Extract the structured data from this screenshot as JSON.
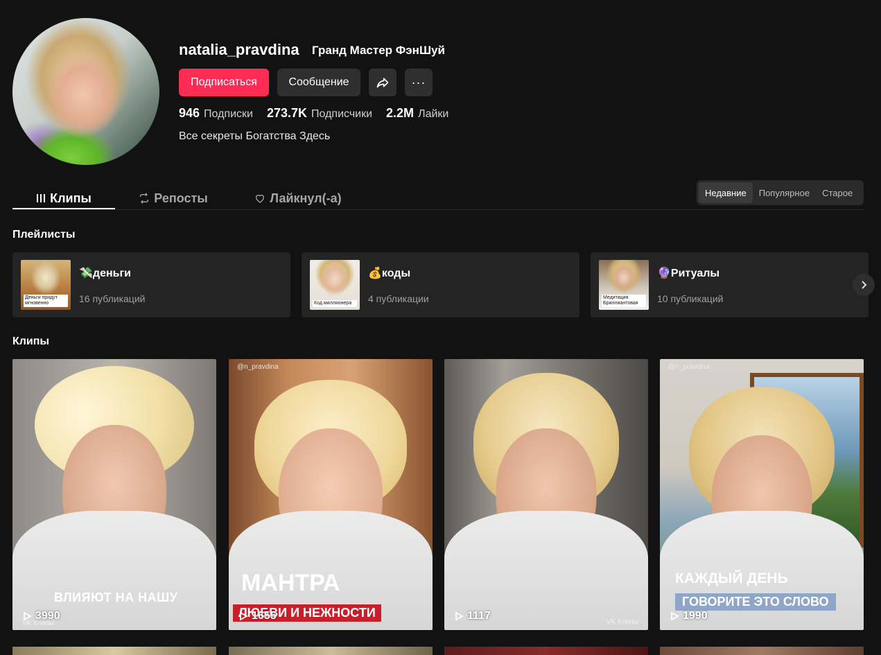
{
  "profile": {
    "username": "natalia_pravdina",
    "nickname": "Гранд Мастер ФэнШуй",
    "follow_label": "Подписаться",
    "message_label": "Сообщение",
    "more_label": "···",
    "stats": [
      {
        "value": "946",
        "label": "Подписки"
      },
      {
        "value": "273.7K",
        "label": "Подписчики"
      },
      {
        "value": "2.2M",
        "label": "Лайки"
      }
    ],
    "bio": "Все секреты Богатства Здесь"
  },
  "tabs": [
    {
      "label": "Клипы",
      "icon": "bars-icon",
      "active": true
    },
    {
      "label": "Репосты",
      "icon": "repost-icon",
      "active": false
    },
    {
      "label": "Лайкнул(-а)",
      "icon": "heart-icon",
      "active": false
    }
  ],
  "sort": [
    "Недавние",
    "Популярное",
    "Старое"
  ],
  "playlists": {
    "title": "Плейлисты",
    "items": [
      {
        "name": "💸деньги",
        "count": "16 публикаций",
        "thumb_caption": "Деньги придут мгновенно"
      },
      {
        "name": "💰коды",
        "count": "4 публикации",
        "thumb_caption": "Код миллионера"
      },
      {
        "name": "🔮Ритуалы",
        "count": "10 публикаций",
        "thumb_caption": "Медитация Бриллиантовая"
      }
    ]
  },
  "clips": {
    "title": "Клипы",
    "items": [
      {
        "views": "3990",
        "handle": "",
        "overlay": "ВЛИЯЮТ НА НАШУ",
        "overlay2": "",
        "watermark": "VK Клипы"
      },
      {
        "views": "1655",
        "handle": "@n_pravdina",
        "overlay": "МАНТРА",
        "overlay2": "ЛЮБВИ И НЕЖНОСТИ",
        "watermark": ""
      },
      {
        "views": "1117",
        "handle": "",
        "overlay": "",
        "overlay2": "",
        "watermark": "VK Клипы"
      },
      {
        "views": "1990",
        "handle": "@n_pravdina",
        "overlay": "КАЖДЫЙ ДЕНЬ",
        "overlay2": "ГОВОРИТЕ ЭТО СЛОВО",
        "watermark": ""
      }
    ]
  },
  "colors": {
    "accent": "#fe2c55",
    "background": "#121212"
  }
}
